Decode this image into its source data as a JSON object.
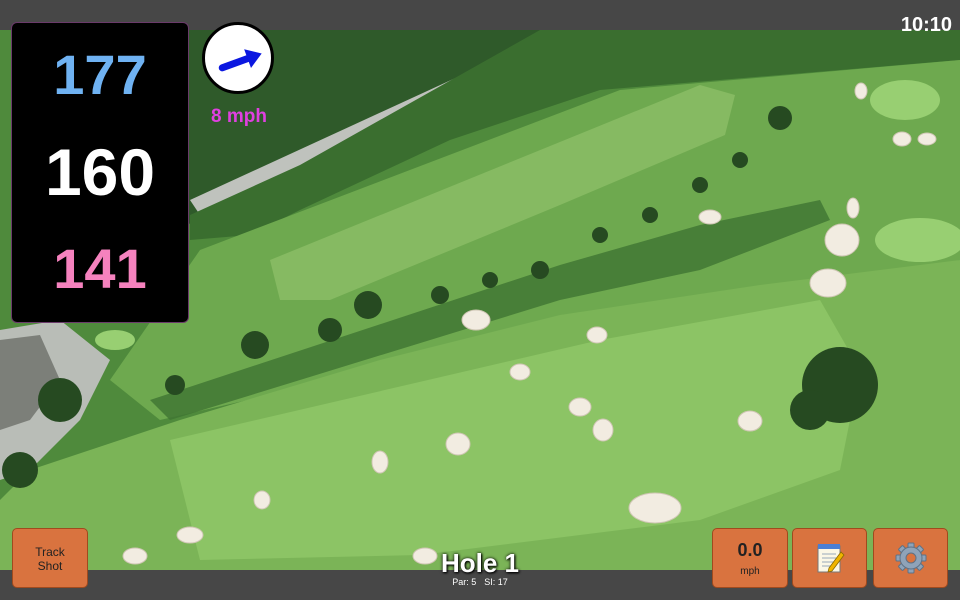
{
  "status": {
    "time": "10:10"
  },
  "distances": {
    "back": "177",
    "center": "160",
    "front": "141"
  },
  "wind": {
    "speed_label": "8 mph",
    "direction_deg": 20
  },
  "hole": {
    "title": "Hole 1",
    "par": "Par: 5",
    "si": "SI: 17"
  },
  "buttons": {
    "track_shot_line1": "Track",
    "track_shot_line2": "Shot",
    "wind_value": "0.0",
    "wind_unit": "mph"
  },
  "icons": {
    "notes": "notepad-icon",
    "settings": "gear-icon",
    "wind": "wind-arrow-icon"
  },
  "colors": {
    "back_distance": "#6fb2f2",
    "center_distance": "#ffffff",
    "front_distance": "#f582be",
    "wind_label": "#e040e0",
    "button": "#d9733f"
  }
}
